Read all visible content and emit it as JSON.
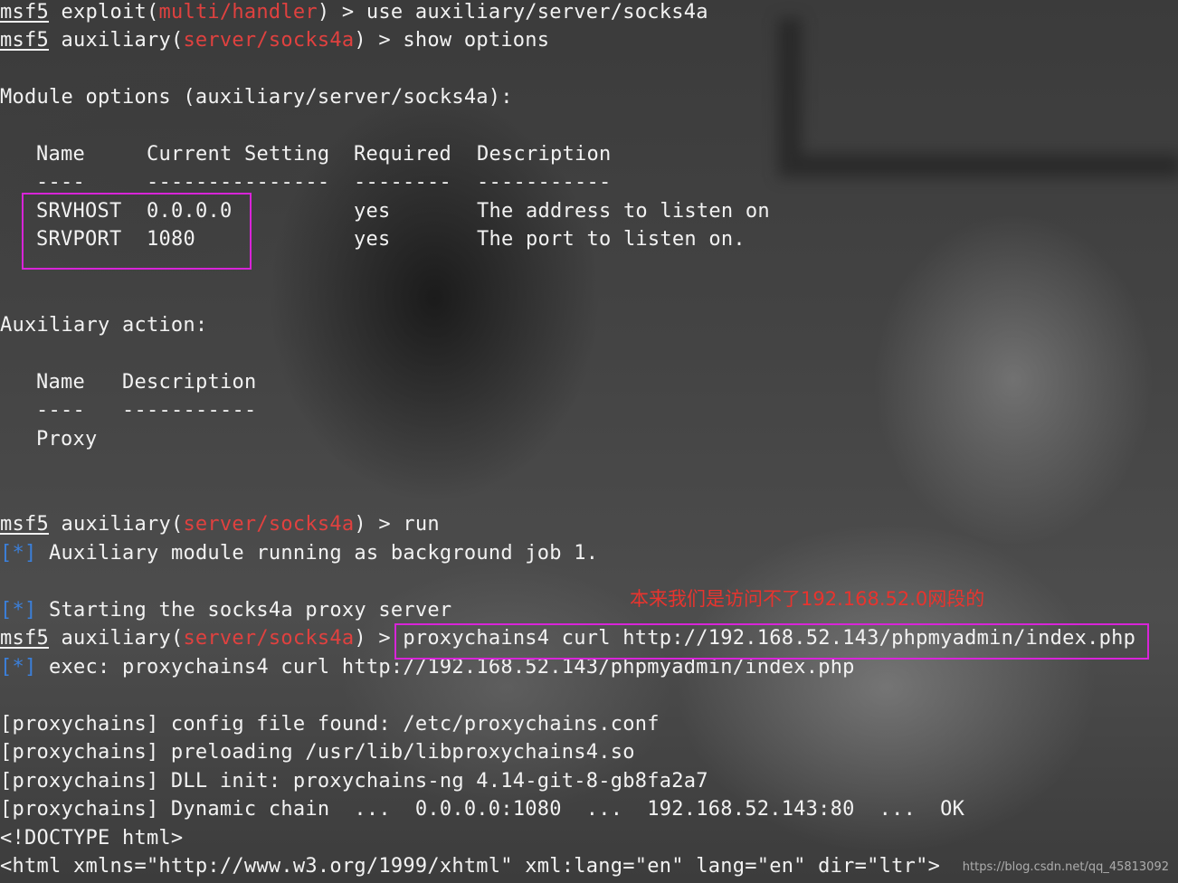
{
  "terminal": {
    "prompt": "msf5",
    "line1": {
      "pre": "exploit(",
      "module": "multi/handler",
      "post": ") > use auxiliary/server/socks4a"
    },
    "line2": {
      "pre": "auxiliary(",
      "module": "server/socks4a",
      "post": ") > show options"
    },
    "module_options_header": "Module options (auxiliary/server/socks4a):",
    "options_table": {
      "headers": [
        "Name",
        "Current Setting",
        "Required",
        "Description"
      ],
      "separators": [
        "----",
        "---------------",
        "--------",
        "-----------"
      ],
      "rows": [
        {
          "name": "SRVHOST",
          "setting": "0.0.0.0",
          "required": "yes",
          "description": "The address to listen on"
        },
        {
          "name": "SRVPORT",
          "setting": "1080",
          "required": "yes",
          "description": "The port to listen on."
        }
      ]
    },
    "aux_action_header": "Auxiliary action:",
    "action_table": {
      "headers": [
        "Name",
        "Description"
      ],
      "separators": [
        "----",
        "-----------"
      ],
      "rows": [
        {
          "name": "Proxy",
          "description": ""
        }
      ]
    },
    "line_run": {
      "pre": "auxiliary(",
      "module": "server/socks4a",
      "post": ") > run"
    },
    "status_marker": "[*]",
    "status1": "Auxiliary module running as background job 1.",
    "status2": "Starting the socks4a proxy server",
    "line_cmd": {
      "pre": "auxiliary(",
      "module": "server/socks4a",
      "post": ") > ",
      "command": "proxychains4 curl http://192.168.52.143/phpmyadmin/index.php"
    },
    "status3": "exec: proxychains4 curl http://192.168.52.143/phpmyadmin/index.php",
    "proxychains": [
      "[proxychains] config file found: /etc/proxychains.conf",
      "[proxychains] preloading /usr/lib/libproxychains4.so",
      "[proxychains] DLL init: proxychains-ng 4.14-git-8-gb8fa2a7",
      "[proxychains] Dynamic chain  ...  0.0.0.0:1080  ...  192.168.52.143:80  ...  OK"
    ],
    "html1": "<!DOCTYPE html>",
    "html2": "<html xmlns=\"http://www.w3.org/1999/xhtml\" xml:lang=\"en\" lang=\"en\" dir=\"ltr\">"
  },
  "annotation": {
    "note": "本来我们是访问不了192.168.52.0网段的",
    "box_color": "#d824d8",
    "note_color": "#e8342e"
  },
  "watermark": "https://blog.csdn.net/qq_45813092"
}
